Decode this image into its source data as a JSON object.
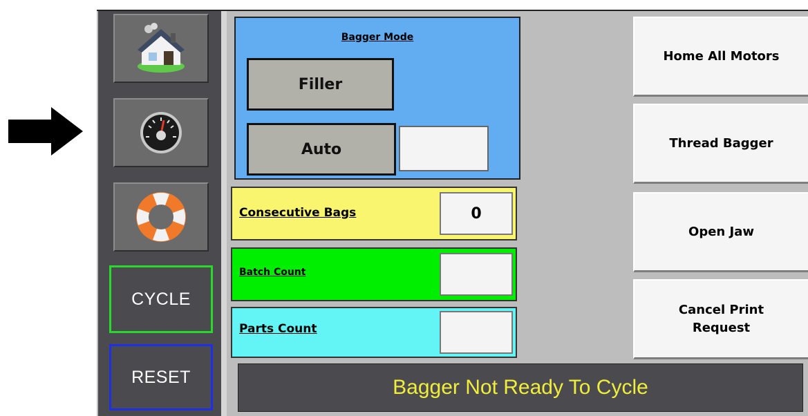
{
  "annotation": {
    "arrow": "arrow-right-icon"
  },
  "sidebar": {
    "icons": [
      {
        "name": "home-icon"
      },
      {
        "name": "gauge-icon"
      },
      {
        "name": "lifebuoy-icon"
      }
    ],
    "cycle_label": "CYCLE",
    "reset_label": "RESET",
    "cycle_border_color": "#29d92b",
    "reset_border_color": "#1f2fe6"
  },
  "bagger_mode": {
    "title": "Bagger Mode",
    "filler_label": "Filler",
    "auto_label": "Auto",
    "auto_value": "",
    "bg_color": "#62acf2"
  },
  "counts": {
    "consecutive_bags": {
      "label": "Consecutive Bags",
      "value": "0",
      "color": "#f9f56e"
    },
    "batch_count": {
      "label": "Batch Count",
      "value": "",
      "color": "#00ee00"
    },
    "parts_count": {
      "label": "Parts Count",
      "value": "",
      "color": "#63f5f5"
    }
  },
  "actions": {
    "home_all_motors": "Home All Motors",
    "thread_bagger": "Thread Bagger",
    "open_jaw": "Open Jaw",
    "cancel_print_line1": "Cancel Print",
    "cancel_print_line2": "Request"
  },
  "status": {
    "message": "Bagger Not Ready To Cycle",
    "text_color": "#f0ee3a"
  }
}
